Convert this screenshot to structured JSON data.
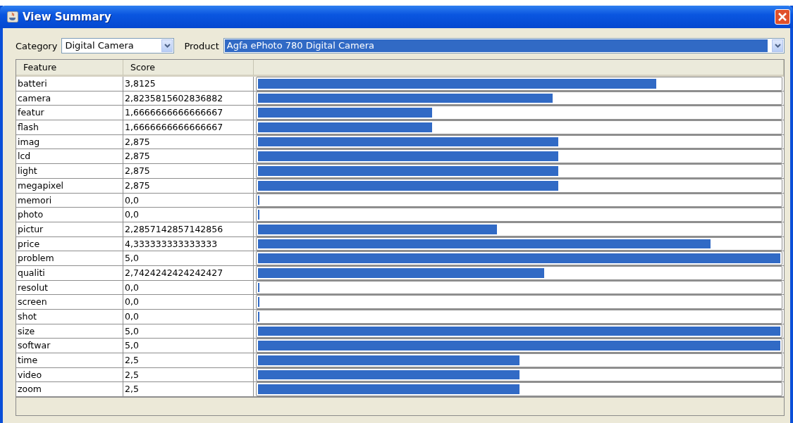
{
  "window": {
    "title": "View Summary"
  },
  "filters": [
    {
      "label": "Category",
      "value": "Digital Camera",
      "highlighted": false
    },
    {
      "label": "Product",
      "value": "Agfa ePhoto 780 Digital Camera",
      "highlighted": true
    }
  ],
  "table": {
    "columns": [
      "Feature",
      "Score"
    ],
    "rows": [
      {
        "feature": "batteri",
        "score": "3,8125",
        "level": 0.7625
      },
      {
        "feature": "camera",
        "score": "2,8235815602836882",
        "level": 0.5647
      },
      {
        "feature": "featur",
        "score": "1,6666666666666667",
        "level": 0.3333
      },
      {
        "feature": "flash",
        "score": "1,6666666666666667",
        "level": 0.3333
      },
      {
        "feature": "imag",
        "score": "2,875",
        "level": 0.575
      },
      {
        "feature": "lcd",
        "score": "2,875",
        "level": 0.575
      },
      {
        "feature": "light",
        "score": "2,875",
        "level": 0.575
      },
      {
        "feature": "megapixel",
        "score": "2,875",
        "level": 0.575
      },
      {
        "feature": "memori",
        "score": "0,0",
        "level": 0
      },
      {
        "feature": "photo",
        "score": "0,0",
        "level": 0
      },
      {
        "feature": "pictur",
        "score": "2,2857142857142856",
        "level": 0.4571
      },
      {
        "feature": "price",
        "score": "4,333333333333333",
        "level": 0.8667
      },
      {
        "feature": "problem",
        "score": "5,0",
        "level": 1
      },
      {
        "feature": "qualiti",
        "score": "2,7424242424242427",
        "level": 0.5485
      },
      {
        "feature": "resolut",
        "score": "0,0",
        "level": 0
      },
      {
        "feature": "screen",
        "score": "0,0",
        "level": 0
      },
      {
        "feature": "shot",
        "score": "0,0",
        "level": 0
      },
      {
        "feature": "size",
        "score": "5,0",
        "level": 1
      },
      {
        "feature": "softwar",
        "score": "5,0",
        "level": 1
      },
      {
        "feature": "time",
        "score": "2,5",
        "level": 0.5
      },
      {
        "feature": "video",
        "score": "2,5",
        "level": 0.5
      },
      {
        "feature": "zoom",
        "score": "2,5",
        "level": 0.5
      }
    ]
  }
}
